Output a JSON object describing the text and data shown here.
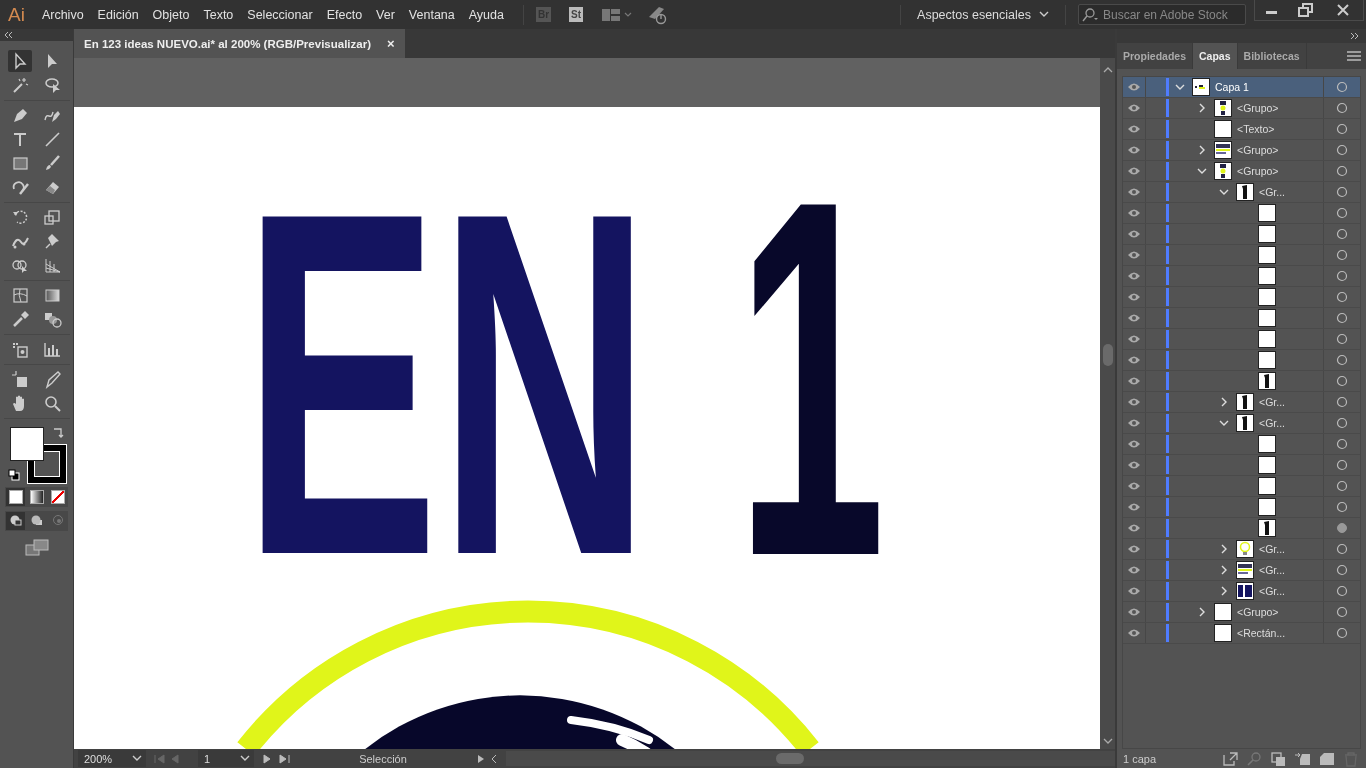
{
  "app": {
    "logo": "Ai",
    "menus": [
      "Archivo",
      "Edición",
      "Objeto",
      "Texto",
      "Seleccionar",
      "Efecto",
      "Ver",
      "Ventana",
      "Ayuda"
    ],
    "bridge": "Br",
    "stock": "St",
    "workspace": "Aspectos esenciales",
    "search": {
      "placeholder": "Buscar en Adobe Stock"
    }
  },
  "document_tab": {
    "title": "En 123 ideas NUEVO.ai* al 200%  (RGB/Previsualizar)",
    "close": "×"
  },
  "toolbar": {
    "groups": [
      [
        {
          "kind": "selection",
          "selected": true
        },
        {
          "kind": "direct-selection",
          "selected": false
        },
        {
          "kind": "magic-wand",
          "selected": false
        },
        {
          "kind": "lasso",
          "selected": false
        }
      ],
      [
        {
          "kind": "pen",
          "selected": false
        },
        {
          "kind": "curvature",
          "selected": false
        },
        {
          "kind": "type",
          "selected": false
        },
        {
          "kind": "line",
          "selected": false
        },
        {
          "kind": "rectangle",
          "selected": false
        },
        {
          "kind": "paintbrush",
          "selected": false
        },
        {
          "kind": "shaper",
          "selected": false
        },
        {
          "kind": "eraser",
          "selected": false
        }
      ],
      [
        {
          "kind": "rotate",
          "selected": false
        },
        {
          "kind": "scale",
          "selected": false
        },
        {
          "kind": "puppet",
          "selected": false
        },
        {
          "kind": "pin",
          "selected": false
        },
        {
          "kind": "shape-builder",
          "selected": false
        },
        {
          "kind": "perspective",
          "selected": false
        }
      ],
      [
        {
          "kind": "mesh",
          "selected": false
        },
        {
          "kind": "gradient",
          "selected": false
        },
        {
          "kind": "eyedropper",
          "selected": false
        },
        {
          "kind": "blend",
          "selected": false
        }
      ],
      [
        {
          "kind": "sprayer",
          "selected": false
        },
        {
          "kind": "graph",
          "selected": false
        }
      ],
      [
        {
          "kind": "artboard",
          "selected": false
        },
        {
          "kind": "knife",
          "selected": false
        },
        {
          "kind": "hand",
          "selected": false
        },
        {
          "kind": "zoom",
          "selected": false
        }
      ]
    ]
  },
  "artwork": {
    "headline": "EN",
    "numeral": "1"
  },
  "status_bar": {
    "zoom": "200%",
    "artboard": "1",
    "tool": "Selección"
  },
  "panel": {
    "tabs": [
      {
        "label": "Propiedades",
        "selected": false
      },
      {
        "label": "Capas",
        "selected": true
      },
      {
        "label": "Bibliotecas",
        "selected": false
      }
    ],
    "layers": [
      {
        "name": "Capa 1",
        "kind": "banner",
        "selected": true,
        "targeted": false,
        "expanded": true,
        "children": [
          {
            "name": "<Grupo>",
            "kind": "figure",
            "selected": false,
            "targeted": false,
            "expanded": false
          },
          {
            "name": "<Texto>",
            "kind": "blank",
            "selected": false,
            "targeted": false
          },
          {
            "name": "<Grupo>",
            "kind": "lines",
            "selected": false,
            "targeted": false,
            "expanded": false
          },
          {
            "name": "<Grupo>",
            "kind": "figure",
            "selected": false,
            "targeted": false,
            "expanded": true,
            "children": [
              {
                "name": "<Gr...",
                "kind": "numeral",
                "selected": false,
                "targeted": false,
                "expanded": true,
                "children": [
                  {
                    "kind": "blank",
                    "selected": false,
                    "targeted": false
                  },
                  {
                    "kind": "blank",
                    "selected": false,
                    "targeted": false
                  },
                  {
                    "kind": "blank",
                    "selected": false,
                    "targeted": false
                  },
                  {
                    "kind": "blank",
                    "selected": false,
                    "targeted": false
                  },
                  {
                    "kind": "blank",
                    "selected": false,
                    "targeted": false
                  },
                  {
                    "kind": "blank",
                    "selected": false,
                    "targeted": false
                  },
                  {
                    "kind": "blank",
                    "selected": false,
                    "targeted": false
                  },
                  {
                    "kind": "blank",
                    "selected": false,
                    "targeted": false
                  },
                  {
                    "kind": "numeral",
                    "selected": false,
                    "targeted": false
                  }
                ]
              },
              {
                "name": "<Gr...",
                "kind": "numeral",
                "selected": false,
                "targeted": false,
                "expanded": false
              },
              {
                "name": "<Gr...",
                "kind": "numeral",
                "selected": false,
                "targeted": false,
                "expanded": true,
                "children": [
                  {
                    "kind": "blank",
                    "selected": false,
                    "targeted": false
                  },
                  {
                    "kind": "blank",
                    "selected": false,
                    "targeted": false
                  },
                  {
                    "kind": "blank",
                    "selected": false,
                    "targeted": false
                  },
                  {
                    "kind": "blank",
                    "selected": false,
                    "targeted": false
                  },
                  {
                    "kind": "numeral",
                    "selected": false,
                    "targeted": true
                  }
                ]
              },
              {
                "name": "<Gr...",
                "kind": "bulb",
                "selected": false,
                "targeted": false,
                "expanded": false
              },
              {
                "name": "<Gr...",
                "kind": "lines",
                "selected": false,
                "targeted": false,
                "expanded": false
              },
              {
                "name": "<Gr...",
                "kind": "dark",
                "selected": false,
                "targeted": false,
                "expanded": false
              }
            ]
          },
          {
            "name": "<Grupo>",
            "kind": "blank",
            "selected": false,
            "targeted": false,
            "expanded": false
          },
          {
            "name": "<Rectán...",
            "kind": "blank",
            "selected": false,
            "targeted": false
          }
        ]
      }
    ],
    "footer": "1 capa"
  }
}
